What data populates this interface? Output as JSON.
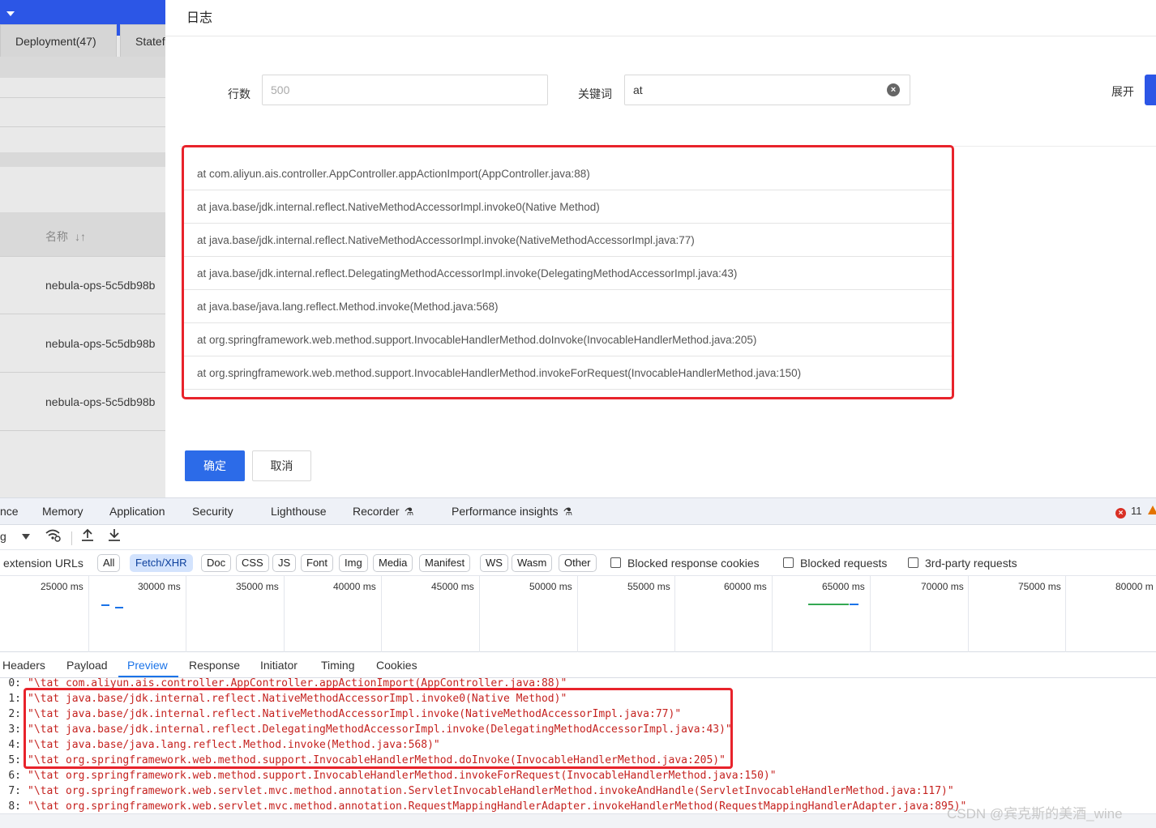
{
  "left_panel": {
    "tabs": [
      "Deployment(47)",
      "Statef"
    ],
    "column_header": "名称",
    "rows": [
      "nebula-ops-5c5db98b",
      "nebula-ops-5c5db98b",
      "nebula-ops-5c5db98b"
    ]
  },
  "dialog": {
    "title": "日志",
    "rows_label": "行数",
    "rows_placeholder": "500",
    "keyword_label": "关键词",
    "keyword_value": "at",
    "expand_label": "展开",
    "log_lines": [
      "at com.aliyun.ais.controller.AppController.appActionImport(AppController.java:88)",
      "at java.base/jdk.internal.reflect.NativeMethodAccessorImpl.invoke0(Native Method)",
      "at java.base/jdk.internal.reflect.NativeMethodAccessorImpl.invoke(NativeMethodAccessorImpl.java:77)",
      "at java.base/jdk.internal.reflect.DelegatingMethodAccessorImpl.invoke(DelegatingMethodAccessorImpl.java:43)",
      "at java.base/java.lang.reflect.Method.invoke(Method.java:568)",
      "at org.springframework.web.method.support.InvocableHandlerMethod.doInvoke(InvocableHandlerMethod.java:205)",
      "at org.springframework.web.method.support.InvocableHandlerMethod.invokeForRequest(InvocableHandlerMethod.java:150)"
    ],
    "ok_label": "确定",
    "cancel_label": "取消"
  },
  "devtools": {
    "tabs": [
      "nce",
      "Memory",
      "Application",
      "Security",
      "Lighthouse",
      "Recorder",
      "Performance insights"
    ],
    "error_count": "11",
    "throttle_label": "g",
    "filter_prefix": "extension URLs",
    "filter_chips": [
      "All",
      "Fetch/XHR",
      "Doc",
      "CSS",
      "JS",
      "Font",
      "Img",
      "Media",
      "Manifest",
      "WS",
      "Wasm",
      "Other"
    ],
    "active_chip": "Fetch/XHR",
    "checkboxes": [
      "Blocked response cookies",
      "Blocked requests",
      "3rd-party requests"
    ],
    "timeline_labels": [
      "25000 ms",
      "30000 ms",
      "35000 ms",
      "40000 ms",
      "45000 ms",
      "50000 ms",
      "55000 ms",
      "60000 ms",
      "65000 ms",
      "70000 ms",
      "75000 ms",
      "80000 m"
    ],
    "detail_tabs": [
      "Headers",
      "Payload",
      "Preview",
      "Response",
      "Initiator",
      "Timing",
      "Cookies"
    ],
    "active_detail_tab": "Preview",
    "preview_lines": [
      {
        "idx": "0:",
        "val": "\"\\tat com.aliyun.ais.controller.AppController.appActionImport(AppController.java:88)\""
      },
      {
        "idx": "1:",
        "val": "\"\\tat java.base/jdk.internal.reflect.NativeMethodAccessorImpl.invoke0(Native Method)\""
      },
      {
        "idx": "2:",
        "val": "\"\\tat java.base/jdk.internal.reflect.NativeMethodAccessorImpl.invoke(NativeMethodAccessorImpl.java:77)\""
      },
      {
        "idx": "3:",
        "val": "\"\\tat java.base/jdk.internal.reflect.DelegatingMethodAccessorImpl.invoke(DelegatingMethodAccessorImpl.java:43)\""
      },
      {
        "idx": "4:",
        "val": "\"\\tat java.base/java.lang.reflect.Method.invoke(Method.java:568)\""
      },
      {
        "idx": "5:",
        "val": "\"\\tat org.springframework.web.method.support.InvocableHandlerMethod.doInvoke(InvocableHandlerMethod.java:205)\""
      },
      {
        "idx": "6:",
        "val": "\"\\tat org.springframework.web.method.support.InvocableHandlerMethod.invokeForRequest(InvocableHandlerMethod.java:150)\""
      },
      {
        "idx": "7:",
        "val": "\"\\tat org.springframework.web.servlet.mvc.method.annotation.ServletInvocableHandlerMethod.invokeAndHandle(ServletInvocableHandlerMethod.java:117)\""
      },
      {
        "idx": "8:",
        "val": "\"\\tat org.springframework.web.servlet.mvc.method.annotation.RequestMappingHandlerAdapter.invokeHandlerMethod(RequestMappingHandlerAdapter.java:895)\""
      }
    ]
  },
  "watermark": "CSDN @宾克斯的美酒_wine",
  "colors": {
    "primary": "#2c56e6",
    "highlight_border": "#e8232b",
    "preview_string": "#c5221f",
    "devtools_active": "#1a73e8"
  }
}
